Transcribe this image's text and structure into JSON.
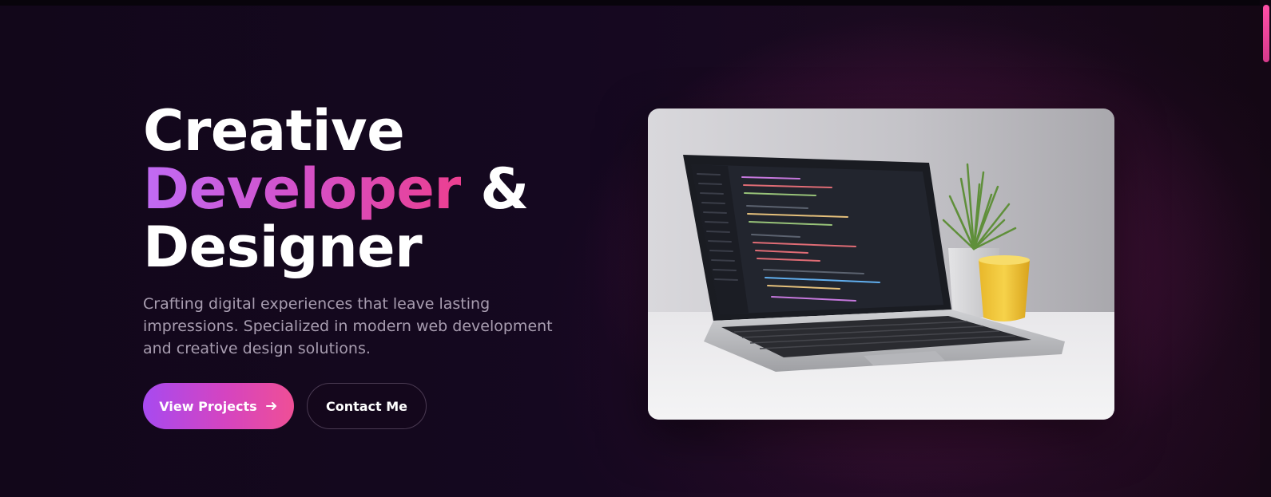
{
  "hero": {
    "title_line1": "Creative",
    "title_highlight": "Developer",
    "title_ampersand": "&",
    "title_line3": "Designer",
    "subtitle": "Crafting digital experiences that leave lasting impressions. Specialized in modern web development and creative design solutions."
  },
  "actions": {
    "primary_label": "View Projects",
    "primary_icon": "arrow-right-icon",
    "secondary_label": "Contact Me"
  },
  "image": {
    "alt": "Laptop displaying code editor on a white desk with a plant and yellow cup"
  },
  "colors": {
    "background": "#12071a",
    "accent_start": "#a74af0",
    "accent_end": "#ef4f96",
    "text_primary": "#ffffff",
    "text_muted": "#a89db0"
  }
}
